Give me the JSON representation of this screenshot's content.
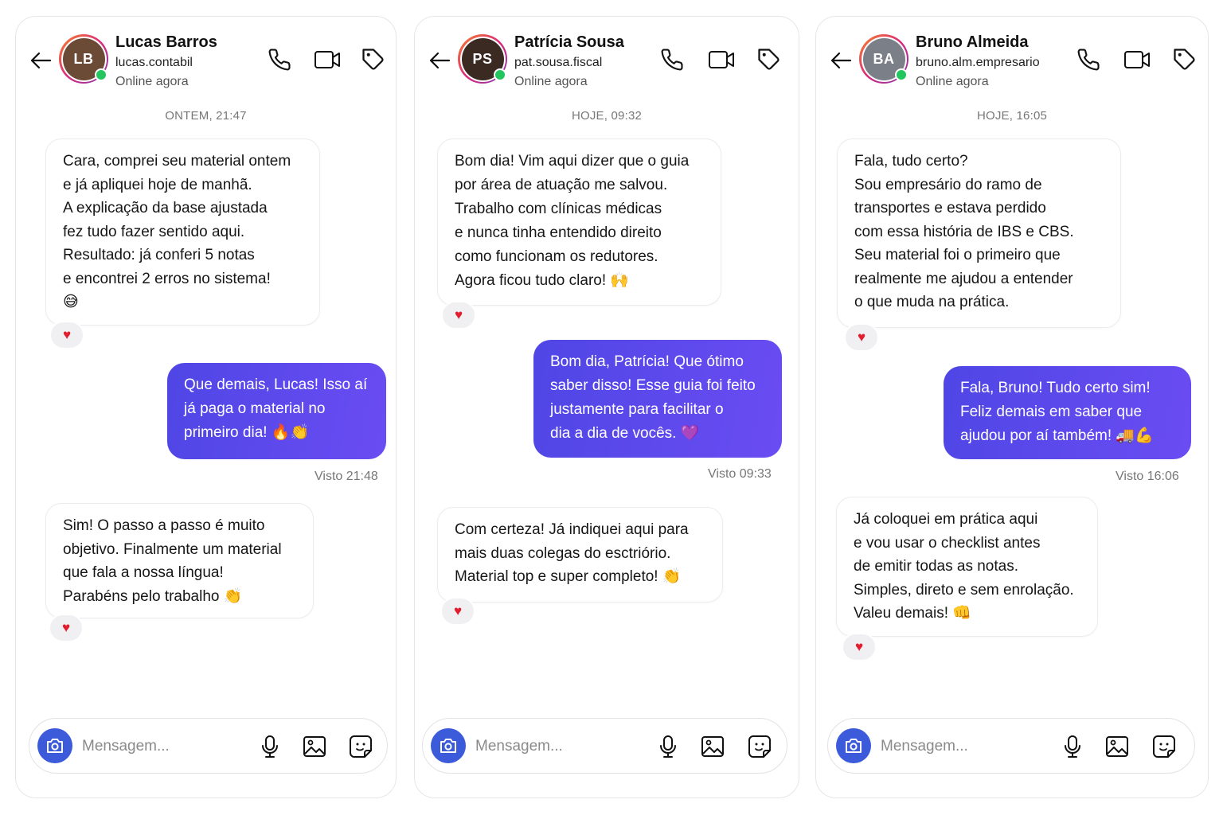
{
  "placeholders": {
    "message": "Mensagem..."
  },
  "colors": {
    "accent": "#4f46e5",
    "online": "#22c55e",
    "heart": "#e11d2e",
    "camera": "#3b5bdb"
  },
  "icons": [
    "back-arrow-icon",
    "phone-icon",
    "video-icon",
    "tag-icon",
    "camera-icon",
    "microphone-icon",
    "image-icon",
    "sticker-icon",
    "heart-icon"
  ],
  "chats": [
    {
      "contact": {
        "name": "Lucas Barros",
        "username": "lucas.contabil",
        "status": "Online agora",
        "initials": "LB",
        "avatar_color": "#6b4a36"
      },
      "date_label": "ONTEM, 21:47",
      "messages": [
        {
          "dir": "in",
          "text": "Cara, comprei seu material ontem\ne já apliquei hoje de manhã.\nA explicação da base ajustada\nfez tudo fazer sentido aqui.\nResultado: já conferi 5 notas\ne encontrei 2 erros no sistema!\n😅",
          "reaction": "♥"
        },
        {
          "dir": "out",
          "text": "Que demais, Lucas! Isso aí\njá paga o material no\nprimeiro dia! 🔥👏"
        },
        {
          "dir": "in",
          "text": "Sim! O passo a passo é muito\nobjetivo. Finalmente um material\nque fala a nossa língua!\nParabéns pelo trabalho 👏",
          "reaction": "♥"
        }
      ],
      "seen": "Visto 21:48"
    },
    {
      "contact": {
        "name": "Patrícia Sousa",
        "username": "pat.sousa.fiscal",
        "status": "Online agora",
        "initials": "PS",
        "avatar_color": "#3b2a22"
      },
      "date_label": "HOJE, 09:32",
      "messages": [
        {
          "dir": "in",
          "text": "Bom dia! Vim aqui dizer que o guia\npor área de atuação me salvou.\nTrabalho com clínicas médicas\ne nunca tinha entendido direito\ncomo funcionam os redutores.\nAgora ficou tudo claro! 🙌",
          "reaction": "♥"
        },
        {
          "dir": "out",
          "text": "Bom dia, Patrícia! Que ótimo\nsaber disso! Esse guia foi feito\njustamente para facilitar o\ndia a dia de vocês. 💜"
        },
        {
          "dir": "in",
          "text": "Com certeza! Já indiquei aqui para\nmais duas colegas do esctriório.\nMaterial top e super completo! 👏",
          "reaction": "♥"
        }
      ],
      "seen": "Visto 09:33"
    },
    {
      "contact": {
        "name": "Bruno Almeida",
        "username": "bruno.alm.empresario",
        "status": "Online agora",
        "initials": "BA",
        "avatar_color": "#7a7f88"
      },
      "date_label": "HOJE, 16:05",
      "messages": [
        {
          "dir": "in",
          "text": "Fala, tudo certo?\nSou empresário do ramo de\ntransportes e estava perdido\ncom essa história de IBS e CBS.\nSeu material foi o primeiro que\nrealmente me ajudou a entender\no que muda na prática.",
          "reaction": "♥"
        },
        {
          "dir": "out",
          "text": "Fala, Bruno! Tudo certo sim!\nFeliz demais em saber que\najudou por aí também! 🚚💪"
        },
        {
          "dir": "in",
          "text": "Já coloquei em prática aqui\ne vou usar o checklist antes\nde emitir todas as notas.\nSimples, direto e sem enrolação.\nValeu demais! 👊",
          "reaction": "♥"
        }
      ],
      "seen": "Visto 16:06"
    }
  ]
}
